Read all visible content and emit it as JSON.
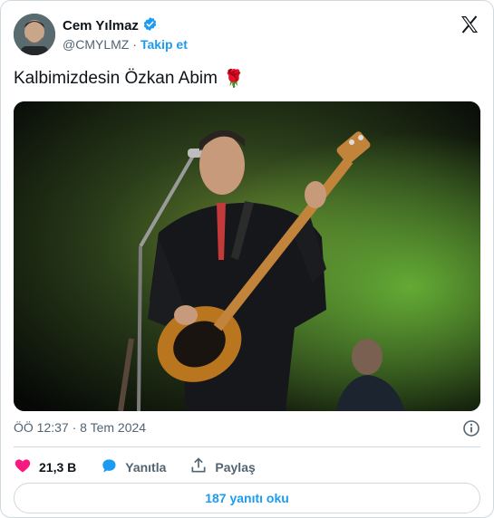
{
  "tweet": {
    "author_name": "Cem Yılmaz",
    "handle": "@CMYLMZ",
    "separator": "·",
    "follow_label": "Takip et",
    "text": "Kalbimizdesin Özkan Abim",
    "emoji": "🌹",
    "timestamp": "ÖÖ 12:37 · 8 Tem 2024"
  },
  "actions": {
    "like_count": "21,3 B",
    "reply_label": "Yanıtla",
    "share_label": "Paylaş"
  },
  "replies_button": "187 yanıtı oku",
  "colors": {
    "accent": "#1d9bf0",
    "like": "#f91880",
    "text": "#0f1419",
    "muted": "#536471",
    "border": "#cfd9de"
  },
  "icons": [
    "verified-badge-icon",
    "x-logo-icon",
    "rose-emoji",
    "info-icon",
    "heart-icon",
    "reply-bubble-icon",
    "share-icon"
  ]
}
